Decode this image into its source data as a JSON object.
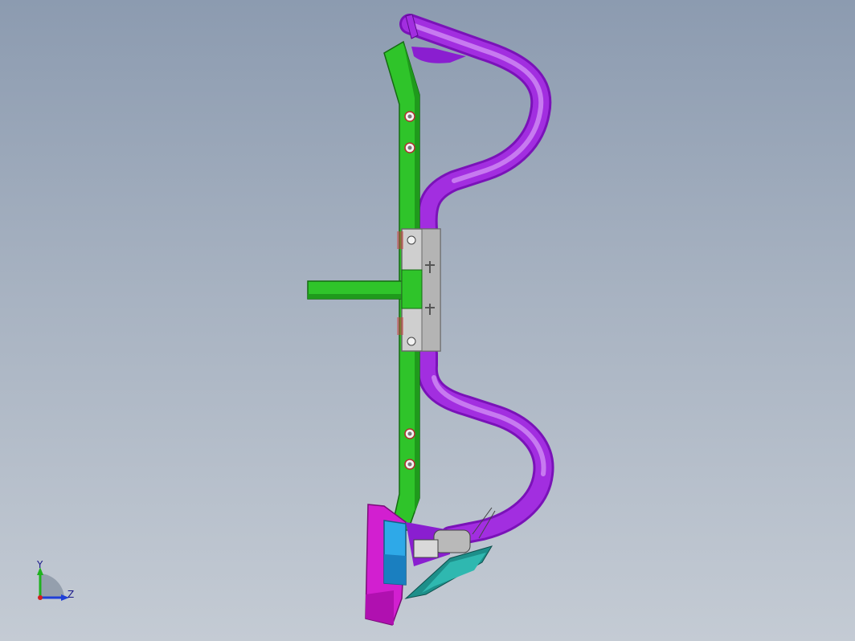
{
  "viewport": {
    "background_top": "#8c9bb0",
    "background_bottom": "#c4cbd4"
  },
  "model": {
    "frame_color": "#2fc42a",
    "tube_color": "#a22ee0",
    "clamp_color": "#c8c8c8",
    "shield_color": "#d21fd0",
    "block_color": "#2ea9e8",
    "blade_color": "#1d8f8a"
  },
  "triad": {
    "y_label": "Y",
    "z_label": "Z",
    "y_color": "#1fb21f",
    "z_color": "#1f3fd8"
  }
}
